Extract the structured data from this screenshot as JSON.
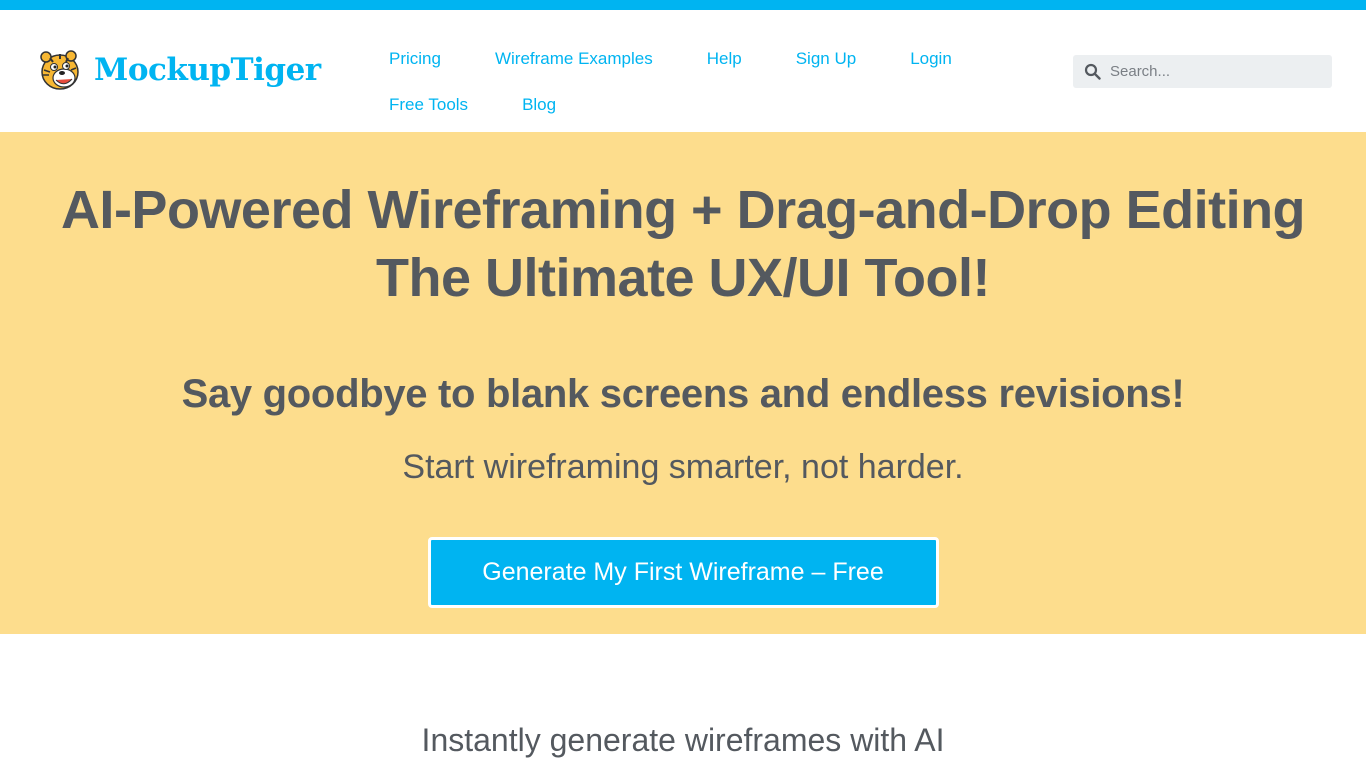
{
  "header": {
    "logo_text": "MockupTiger",
    "nav_row1": [
      "Pricing",
      "Wireframe Examples",
      "Help",
      "Sign Up",
      "Login"
    ],
    "nav_row2": [
      "Free Tools",
      "Blog"
    ],
    "search_placeholder": "Search...",
    "search_icon": "search-icon"
  },
  "hero": {
    "title_line1": "AI-Powered Wireframing + Drag-and-Drop Editing",
    "title_line2": "The Ultimate UX/UI Tool!",
    "subtitle": "Say goodbye to blank screens and endless revisions!",
    "tagline": "Start wireframing smarter, not harder.",
    "cta_label": "Generate My First Wireframe – Free"
  },
  "section": {
    "title": "Instantly generate wireframes with AI"
  },
  "colors": {
    "accent": "#00b4f1",
    "hero_bg": "#fddd8d",
    "text": "#54595f"
  }
}
